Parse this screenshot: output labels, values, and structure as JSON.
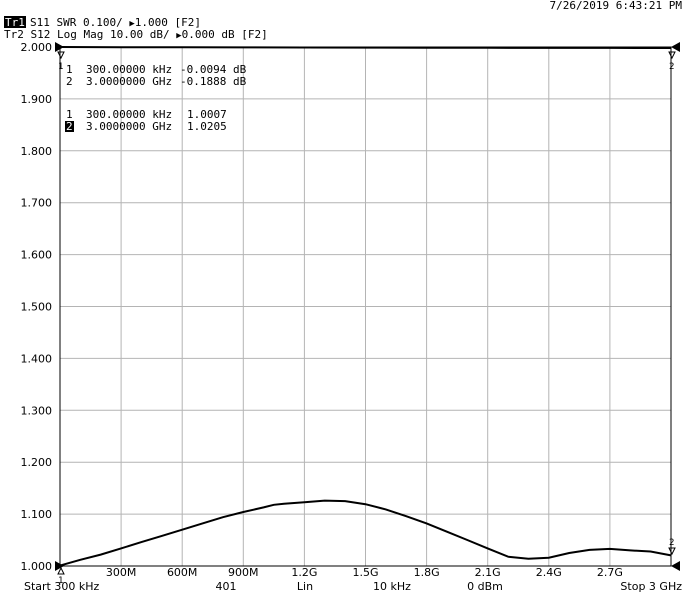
{
  "header": {
    "datetime": "7/26/2019  6:43:21 PM",
    "trace1_tag": "Tr1",
    "trace1_text": "S11  SWR  0.100/ ",
    "trace1_ref_arrow": "▶",
    "trace1_ref": "1.000  [F2]",
    "trace2_text": "Tr2  S12  Log Mag 10.00 dB/ ",
    "trace2_ref_arrow": "▶",
    "trace2_ref": "0.000 dB  [F2]"
  },
  "markers": {
    "trace2": [
      {
        "id": "1",
        "freq": "300.00000 kHz",
        "value": "-0.0094 dB"
      },
      {
        "id": "2",
        "freq": "3.0000000 GHz",
        "value": "-0.1888 dB"
      }
    ],
    "trace1": [
      {
        "id": "1",
        "freq": "300.00000 kHz",
        "value": "1.0007"
      },
      {
        "id": "2",
        "freq": "3.0000000 GHz",
        "value": "1.0205"
      }
    ]
  },
  "footer": {
    "start": "Start  300 kHz",
    "points": "401",
    "sweep": "Lin",
    "ifbw": "10 kHz",
    "power": "0 dBm",
    "stop": "Stop  3 GHz"
  },
  "chart_data": {
    "type": "line",
    "xlabels": [
      "300M",
      "600M",
      "900M",
      "1.2G",
      "1.5G",
      "1.8G",
      "2.1G",
      "2.4G",
      "2.7G"
    ],
    "ylabels": [
      "2.000",
      "1.900",
      "1.800",
      "1.700",
      "1.600",
      "1.500",
      "1.400",
      "1.300",
      "1.200",
      "1.100",
      "1.000"
    ],
    "xlim_ghz": [
      0.0003,
      3.0
    ],
    "ylim": [
      1.0,
      2.0
    ],
    "grid": true,
    "series": [
      {
        "name": "S11 SWR",
        "color": "#000000",
        "x_ghz": [
          0.0003,
          0.1,
          0.2,
          0.3,
          0.4,
          0.5,
          0.6,
          0.7,
          0.8,
          0.9,
          1.0,
          1.05,
          1.1,
          1.2,
          1.3,
          1.4,
          1.5,
          1.6,
          1.7,
          1.8,
          1.9,
          2.0,
          2.1,
          2.2,
          2.3,
          2.4,
          2.5,
          2.6,
          2.7,
          2.8,
          2.9,
          3.0
        ],
        "y": [
          1.0007,
          1.012,
          1.022,
          1.034,
          1.046,
          1.058,
          1.07,
          1.082,
          1.094,
          1.104,
          1.113,
          1.118,
          1.12,
          1.123,
          1.126,
          1.125,
          1.119,
          1.109,
          1.096,
          1.082,
          1.066,
          1.05,
          1.034,
          1.018,
          1.014,
          1.016,
          1.025,
          1.031,
          1.033,
          1.03,
          1.028,
          1.0205
        ]
      },
      {
        "name": "S12 Log Mag",
        "color": "#000000",
        "x_ghz": [
          0.0003,
          0.3,
          0.6,
          0.9,
          1.2,
          1.5,
          1.8,
          2.1,
          2.4,
          2.7,
          3.0
        ],
        "y_db": [
          -0.0094,
          -0.03,
          -0.05,
          -0.07,
          -0.09,
          -0.11,
          -0.13,
          -0.15,
          -0.17,
          -0.18,
          -0.1888
        ]
      }
    ]
  }
}
